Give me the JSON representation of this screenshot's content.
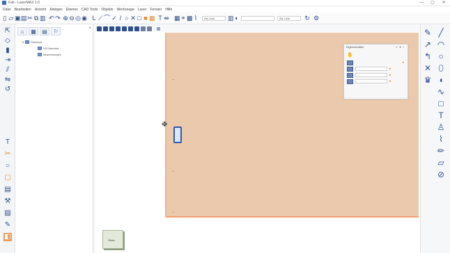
{
  "window": {
    "title": "Fab - LaserMAX 1.0",
    "controls": [
      "—",
      "▢",
      "✕"
    ]
  },
  "menu": [
    "Datei",
    "Bearbeiten",
    "Ansicht",
    "Anlegen",
    "Ebenen",
    "CAD Tools",
    "Objekte",
    "Werkzeuge",
    "Laser",
    "Fenster",
    "Hilfe"
  ],
  "toolbar": {
    "combo_1": "Als Linie",
    "combo_2": "",
    "combo_3": "Als Linie"
  },
  "tree": {
    "root": "Standard",
    "children": [
      "Ulf Standard",
      "Bearbeitungen"
    ]
  },
  "mini_panel": {
    "title": "Eigenschaften",
    "controls": "× ▾ ▪"
  },
  "viewcube": {
    "label": "Oben"
  },
  "colors": {
    "sheet": "#ebc9ad",
    "accent_icon": "#2d4f8e",
    "sheet_edge": "#f2a36f"
  }
}
